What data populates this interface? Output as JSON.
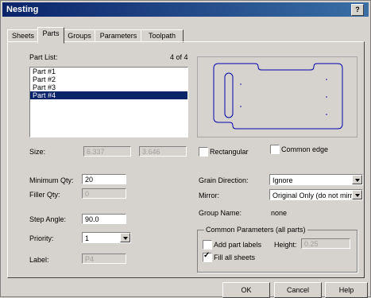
{
  "window": {
    "title": "Nesting",
    "help_icon": "?"
  },
  "tabs": [
    "Sheets",
    "Parts",
    "Groups",
    "Parameters",
    "Toolpath"
  ],
  "part_list": {
    "label": "Part List:",
    "count": "4 of 4",
    "items": [
      "Part #1",
      "Part #2",
      "Part #3",
      "Part #4"
    ],
    "selected": "Part #4"
  },
  "size": {
    "label": "Size:",
    "width": "6.337",
    "height": "3.646"
  },
  "rectangular": {
    "label": "Rectangular",
    "checked": false
  },
  "common_edge": {
    "label": "Common edge",
    "checked": false
  },
  "minimum_qty": {
    "label": "Minimum Qty:",
    "value": "20"
  },
  "filler_qty": {
    "label": "Filler Qty:",
    "value": "0"
  },
  "step_angle": {
    "label": "Step Angle:",
    "value": "90.0"
  },
  "priority": {
    "label": "Priority:",
    "value": "1"
  },
  "label_field": {
    "label": "Label:",
    "value": "P4"
  },
  "grain_direction": {
    "label": "Grain Direction:",
    "value": "Ignore"
  },
  "mirror": {
    "label": "Mirror:",
    "value": "Original Only (do not mirro"
  },
  "group_name": {
    "label": "Group Name:",
    "value": "none"
  },
  "common_params": {
    "caption": "Common Parameters (all parts)",
    "add_labels": {
      "label": "Add part labels",
      "checked": false
    },
    "height": {
      "label": "Height:",
      "value": "0.25"
    },
    "fill_all": {
      "label": "Fill all sheets",
      "checked": true
    }
  },
  "buttons": {
    "ok": "OK",
    "cancel": "Cancel",
    "help": "Help"
  }
}
